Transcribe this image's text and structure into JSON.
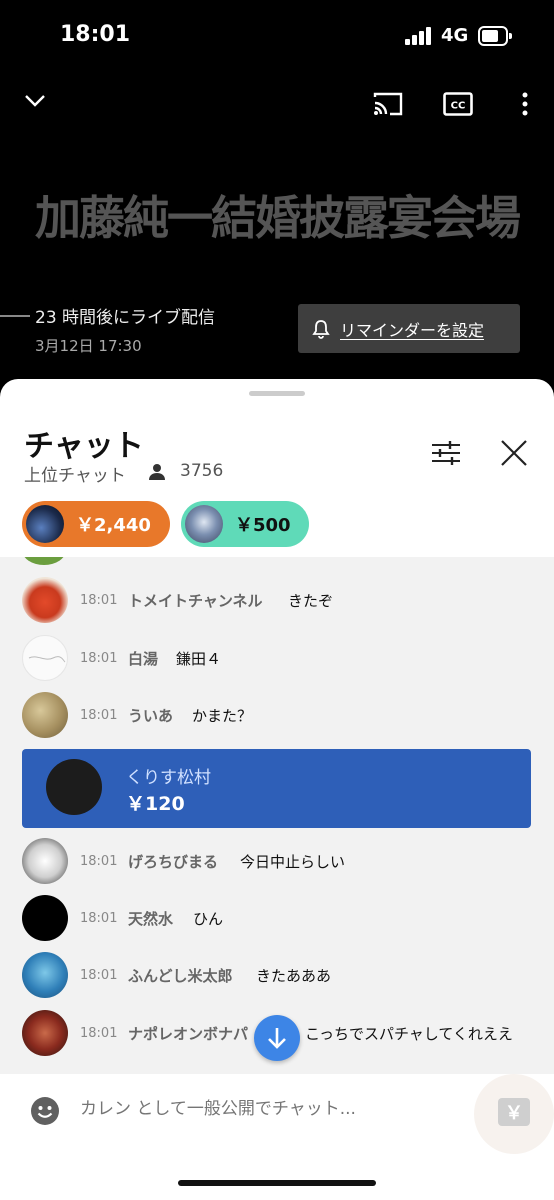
{
  "status_bar": {
    "time": "18:01",
    "network": "4G"
  },
  "video": {
    "title": "加藤純一結婚披露宴会場",
    "live_status": "23 時間後にライブ配信",
    "scheduled_date": "3月12日 17:30",
    "reminder_label": "リマインダーを設定",
    "icons": {
      "collapse": "chevron-down-icon",
      "cast": "cast-icon",
      "captions": "cc-icon",
      "more": "more-vert-icon"
    }
  },
  "chat": {
    "title": "チャット",
    "mode": "上位チャット",
    "viewer_count": "3756",
    "tickers": [
      {
        "amount": "￥2,440",
        "color": "#e8782a"
      },
      {
        "amount": "￥500",
        "color": "#5fdab8"
      }
    ],
    "messages": [
      {
        "time": "18:01",
        "author": "トメイトチャンネル",
        "text": "きたぞ"
      },
      {
        "time": "18:01",
        "author": "白湯",
        "text": "鎌田４"
      },
      {
        "time": "18:01",
        "author": "ういあ",
        "text": "かまた？"
      },
      {
        "time": "18:01",
        "author": "げろちびまる",
        "text": "今日中止らしい"
      },
      {
        "time": "18:01",
        "author": "天然水",
        "text": "ひん"
      },
      {
        "time": "18:01",
        "author": "ふんどし米太郎",
        "text": "きたあああ"
      },
      {
        "time": "18:01",
        "author": "ナポレオンボナパ",
        "text": "こっちでスパチャしてくれええ"
      }
    ],
    "superchat": {
      "author": "くりす松村",
      "amount": "￥120",
      "color": "#2e5fb8"
    },
    "input_placeholder": "カレン として一般公開でチャット...",
    "superchat_button": "￥"
  }
}
